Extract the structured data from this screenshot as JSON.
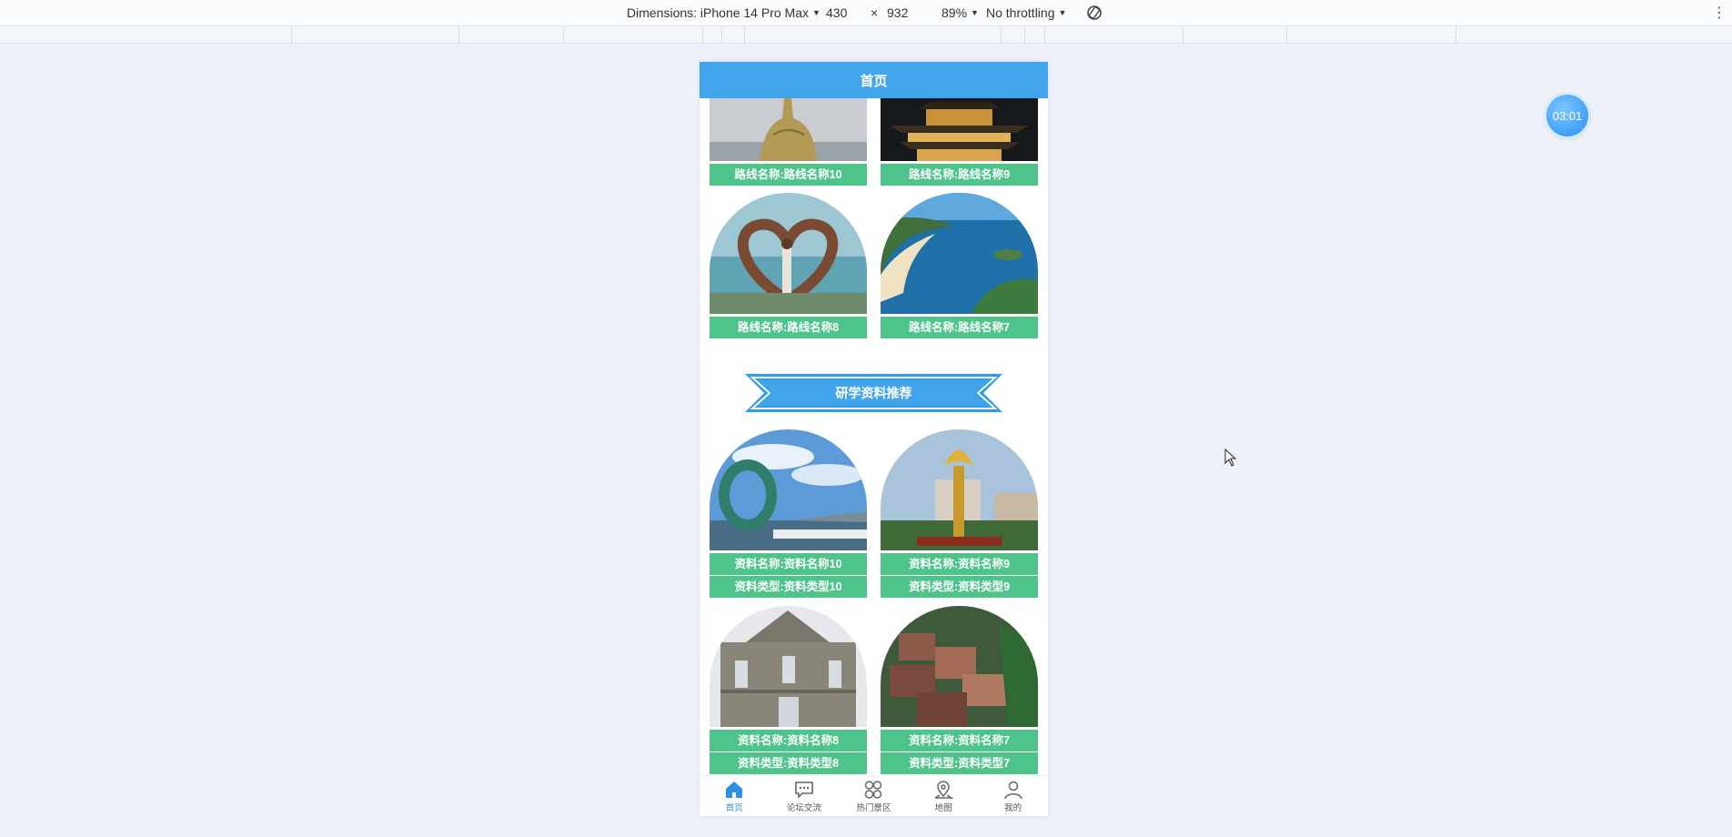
{
  "devtools": {
    "dimensions_label": "Dimensions: iPhone 14 Pro Max",
    "width": "430",
    "times": "×",
    "height": "932",
    "zoom": "89%",
    "throttling": "No throttling"
  },
  "timer": "03:01",
  "header": {
    "title": "首页"
  },
  "routes": [
    {
      "label": "路线名称:路线名称10"
    },
    {
      "label": "路线名称:路线名称9"
    },
    {
      "label": "路线名称:路线名称8"
    },
    {
      "label": "路线名称:路线名称7"
    }
  ],
  "section": {
    "title": "研学资料推荐"
  },
  "materials": [
    {
      "name": "资料名称:资料名称10",
      "type": "资料类型:资料类型10"
    },
    {
      "name": "资料名称:资料名称9",
      "type": "资料类型:资料类型9"
    },
    {
      "name": "资料名称:资料名称8",
      "type": "资料类型:资料类型8"
    },
    {
      "name": "资料名称:资料名称7",
      "type": "资料类型:资料类型7"
    }
  ],
  "tabbar": {
    "items": [
      {
        "label": "首页",
        "icon": "home-icon",
        "active": true
      },
      {
        "label": "论坛交流",
        "icon": "chat-icon",
        "active": false
      },
      {
        "label": "热门景区",
        "icon": "grid-icon",
        "active": false
      },
      {
        "label": "地图",
        "icon": "map-pin-icon",
        "active": false
      },
      {
        "label": "我的",
        "icon": "user-icon",
        "active": false
      }
    ]
  },
  "colors": {
    "header": "#42a5ec",
    "label_green": "#4ec48a",
    "accent_blue": "#2f8fe0"
  }
}
